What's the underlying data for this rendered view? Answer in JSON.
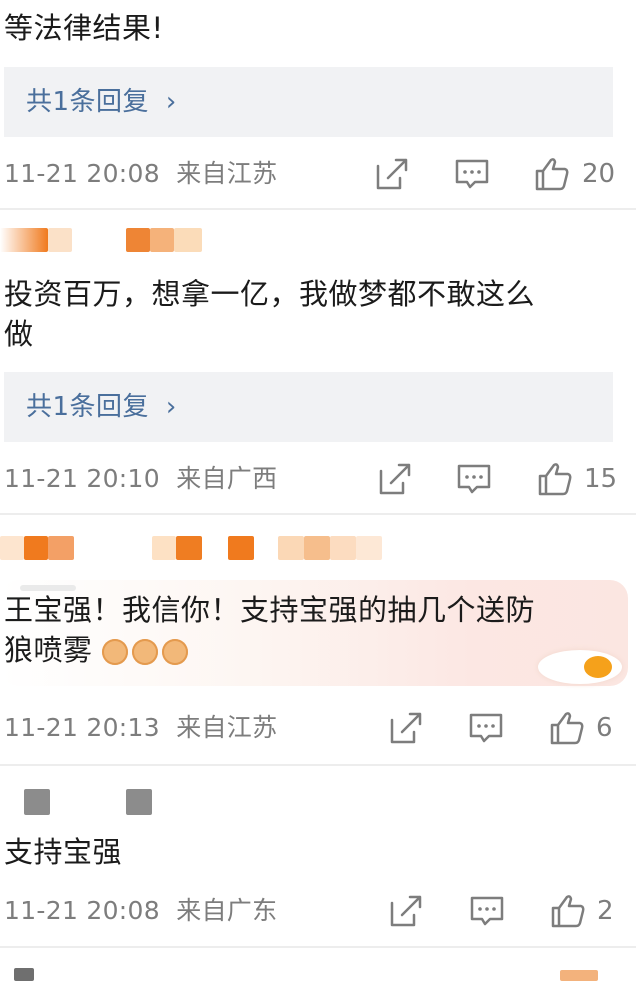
{
  "comments": [
    {
      "text_lines": [
        "等法律结果!"
      ],
      "reply_label": "共1条回复",
      "time": "11-21 20:08",
      "location": "来自江苏",
      "likes": "20"
    },
    {
      "text_lines": [
        "投资百万，想拿一亿，我做梦都不敢这么",
        "做"
      ],
      "reply_label": "共1条回复",
      "time": "11-21 20:10",
      "location": "来自广西",
      "likes": "15"
    },
    {
      "text_lines": [
        "王宝强！我信你！支持宝强的抽几个送防",
        "狼喷雾"
      ],
      "time": "11-21 20:13",
      "location": "来自江苏",
      "likes": "6"
    },
    {
      "text_lines": [
        "支持宝强"
      ],
      "time": "11-21 20:08",
      "location": "来自广东",
      "likes": "2"
    }
  ],
  "icons": {
    "share": "share-icon",
    "comment": "comment-icon",
    "like": "thumbs-up-icon"
  },
  "colors": {
    "link": "#4a6f9c",
    "meta": "#7d7d7d",
    "reply_bg": "#f1f2f4",
    "blur_orange": "#f07a1e"
  }
}
